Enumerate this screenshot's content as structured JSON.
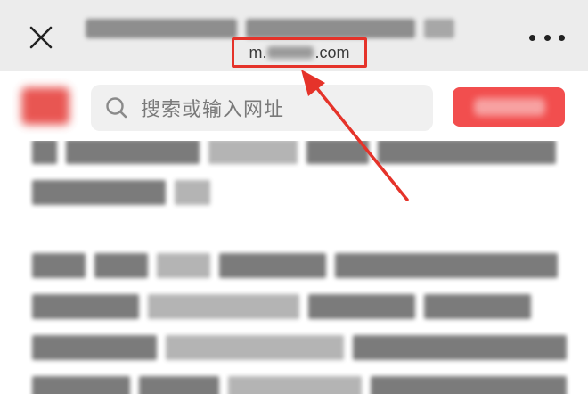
{
  "header": {
    "url_prefix": "m.",
    "url_suffix": ".com"
  },
  "search": {
    "placeholder": "搜索或输入网址"
  },
  "colors": {
    "title_bar": "#ececec",
    "annotation": "#e5332a",
    "action_button": "#f24e4e",
    "search_field": "#f0f0f0"
  },
  "icons": {
    "close": "close-icon",
    "more": "more-dots-icon",
    "search": "search-icon"
  }
}
